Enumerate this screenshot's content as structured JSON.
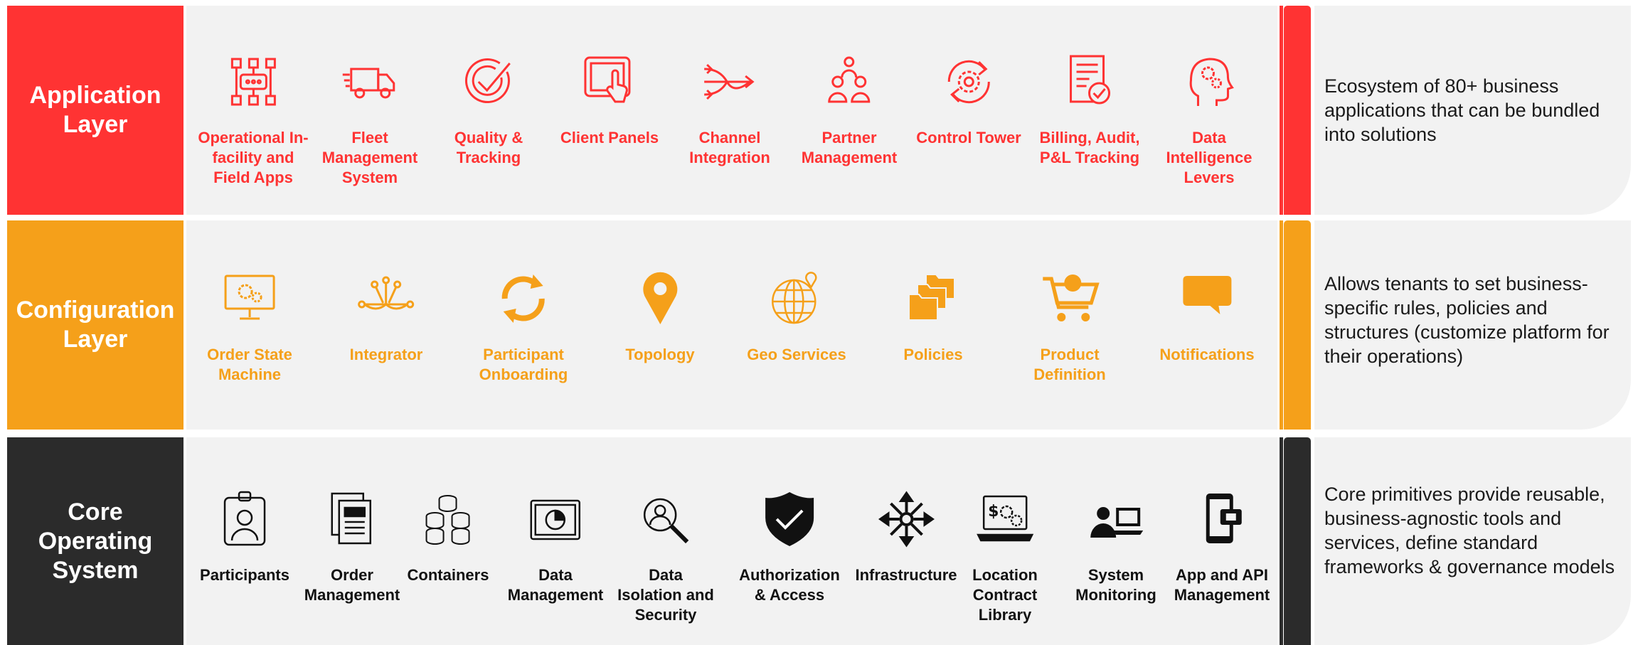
{
  "colors": {
    "application": "#ff3333",
    "configuration": "#f5a01a",
    "core": "#2b2b2b",
    "panel": "#f2f2f2"
  },
  "layers": {
    "application": {
      "label": "Application\nLayer",
      "description": "Ecosystem of 80+ business applications that can be bundled into solutions",
      "items": [
        {
          "label": "Operational In-\nfacility and\nField Apps",
          "icon": "network-nodes-icon"
        },
        {
          "label": "Fleet\nManagement\nSystem",
          "icon": "truck-icon"
        },
        {
          "label": "Quality &\nTracking",
          "icon": "checkmark-badge-icon"
        },
        {
          "label": "Client Panels",
          "icon": "touch-tablet-icon"
        },
        {
          "label": "Channel\nIntegration",
          "icon": "merge-arrows-icon"
        },
        {
          "label": "Partner\nManagement",
          "icon": "people-group-icon"
        },
        {
          "label": "Control Tower",
          "icon": "gear-cycle-icon"
        },
        {
          "label": "Billing, Audit,\nP&L Tracking",
          "icon": "document-check-icon"
        },
        {
          "label": "Data\nIntelligence\nLevers",
          "icon": "head-gears-icon"
        }
      ]
    },
    "configuration": {
      "label": "Configuration\nLayer",
      "description": "Allows tenants to set business-specific rules, policies and structures (customize platform for their operations)",
      "items": [
        {
          "label": "Order State\nMachine",
          "icon": "monitor-gears-icon"
        },
        {
          "label": "Integrator",
          "icon": "integration-hub-icon"
        },
        {
          "label": "Participant\nOnboarding",
          "icon": "refresh-cycle-icon"
        },
        {
          "label": "Topology",
          "icon": "map-pin-icon"
        },
        {
          "label": "Geo Services",
          "icon": "globe-pin-icon"
        },
        {
          "label": "Policies",
          "icon": "folders-icon"
        },
        {
          "label": "Product\nDefinition",
          "icon": "shopping-cart-icon"
        },
        {
          "label": "Notifications",
          "icon": "chat-bubble-icon"
        }
      ]
    },
    "core": {
      "label": "Core\nOperating\nSystem",
      "description": "Core primitives provide reusable, business-agnostic tools and services, define standard frameworks & governance models",
      "items": [
        {
          "label": "Participants",
          "icon": "id-badge-icon"
        },
        {
          "label": "Order\nManagement",
          "icon": "documents-icon"
        },
        {
          "label": "Containers",
          "icon": "database-stack-icon"
        },
        {
          "label": "Data\nManagement",
          "icon": "pie-tablet-icon"
        },
        {
          "label": "Data\nIsolation and\nSecurity",
          "icon": "user-magnifier-icon"
        },
        {
          "label": "Authorization\n& Access",
          "icon": "shield-check-icon"
        },
        {
          "label": "Infrastructure",
          "icon": "expand-arrows-icon"
        },
        {
          "label": "Location\nContract\nLibrary",
          "icon": "laptop-gears-icon"
        },
        {
          "label": "System\nMonitoring",
          "icon": "person-computer-icon"
        },
        {
          "label": "App and API\nManagement",
          "icon": "phone-card-icon"
        }
      ]
    }
  }
}
